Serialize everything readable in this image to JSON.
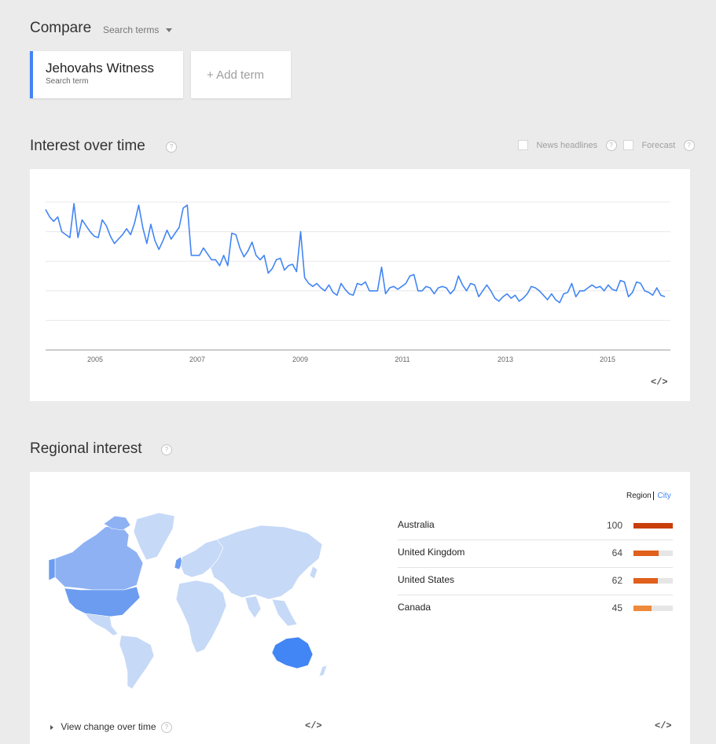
{
  "compare": {
    "title": "Compare",
    "dropdown_label": "Search terms",
    "term": {
      "name": "Jehovahs Witness",
      "sublabel": "Search term"
    },
    "add_term": "+ Add term"
  },
  "interest_over_time": {
    "title": "Interest over time",
    "help": "?",
    "options": [
      {
        "label": "News headlines",
        "checked": false
      },
      {
        "label": "Forecast",
        "checked": false
      }
    ],
    "embed": "</>"
  },
  "chart_data": {
    "type": "line",
    "title": "",
    "xlabel": "",
    "ylabel": "",
    "xtick_labels": [
      "2005",
      "2007",
      "2009",
      "2011",
      "2013",
      "2015"
    ],
    "ylim": [
      0,
      100
    ],
    "grid": true,
    "series": [
      {
        "color": "#4285f4",
        "values": [
          95,
          90,
          87,
          90,
          80,
          78,
          76,
          99,
          76,
          88,
          84,
          80,
          77,
          76,
          88,
          84,
          77,
          72,
          75,
          78,
          82,
          78,
          86,
          98,
          83,
          72,
          85,
          74,
          68,
          74,
          81,
          75,
          79,
          83,
          96,
          98,
          64,
          64,
          64,
          69,
          65,
          61,
          61,
          57,
          64,
          57,
          79,
          78,
          69,
          63,
          67,
          73,
          64,
          61,
          64,
          52,
          55,
          61,
          62,
          54,
          57,
          58,
          53,
          80,
          49,
          45,
          43,
          45,
          42,
          40,
          44,
          39,
          37,
          45,
          41,
          38,
          37,
          45,
          44,
          46,
          40,
          40,
          40,
          56,
          38,
          42,
          43,
          41,
          43,
          45,
          50,
          51,
          40,
          40,
          43,
          42,
          38,
          42,
          43,
          42,
          38,
          41,
          50,
          44,
          40,
          45,
          44,
          36,
          40,
          44,
          40,
          35,
          33,
          36,
          38,
          35,
          37,
          33,
          35,
          38,
          43,
          42,
          40,
          37,
          34,
          38,
          34,
          32,
          38,
          39,
          45,
          36,
          40,
          40,
          42,
          44,
          42,
          43,
          40,
          44,
          41,
          40,
          47,
          46,
          36,
          39,
          46,
          45,
          40,
          39,
          37,
          42,
          37,
          36
        ]
      }
    ]
  },
  "regional_interest": {
    "title": "Regional interest",
    "help": "?",
    "toggle": {
      "region": "Region",
      "city": "City"
    },
    "rows": [
      {
        "name": "Australia",
        "value": 100,
        "color": "#c83f0b"
      },
      {
        "name": "United Kingdom",
        "value": 64,
        "color": "#e0601c"
      },
      {
        "name": "United States",
        "value": 62,
        "color": "#e0601c"
      },
      {
        "name": "Canada",
        "value": 45,
        "color": "#ee8a3c"
      }
    ],
    "view_change": "View change over time",
    "embed": "</>"
  }
}
